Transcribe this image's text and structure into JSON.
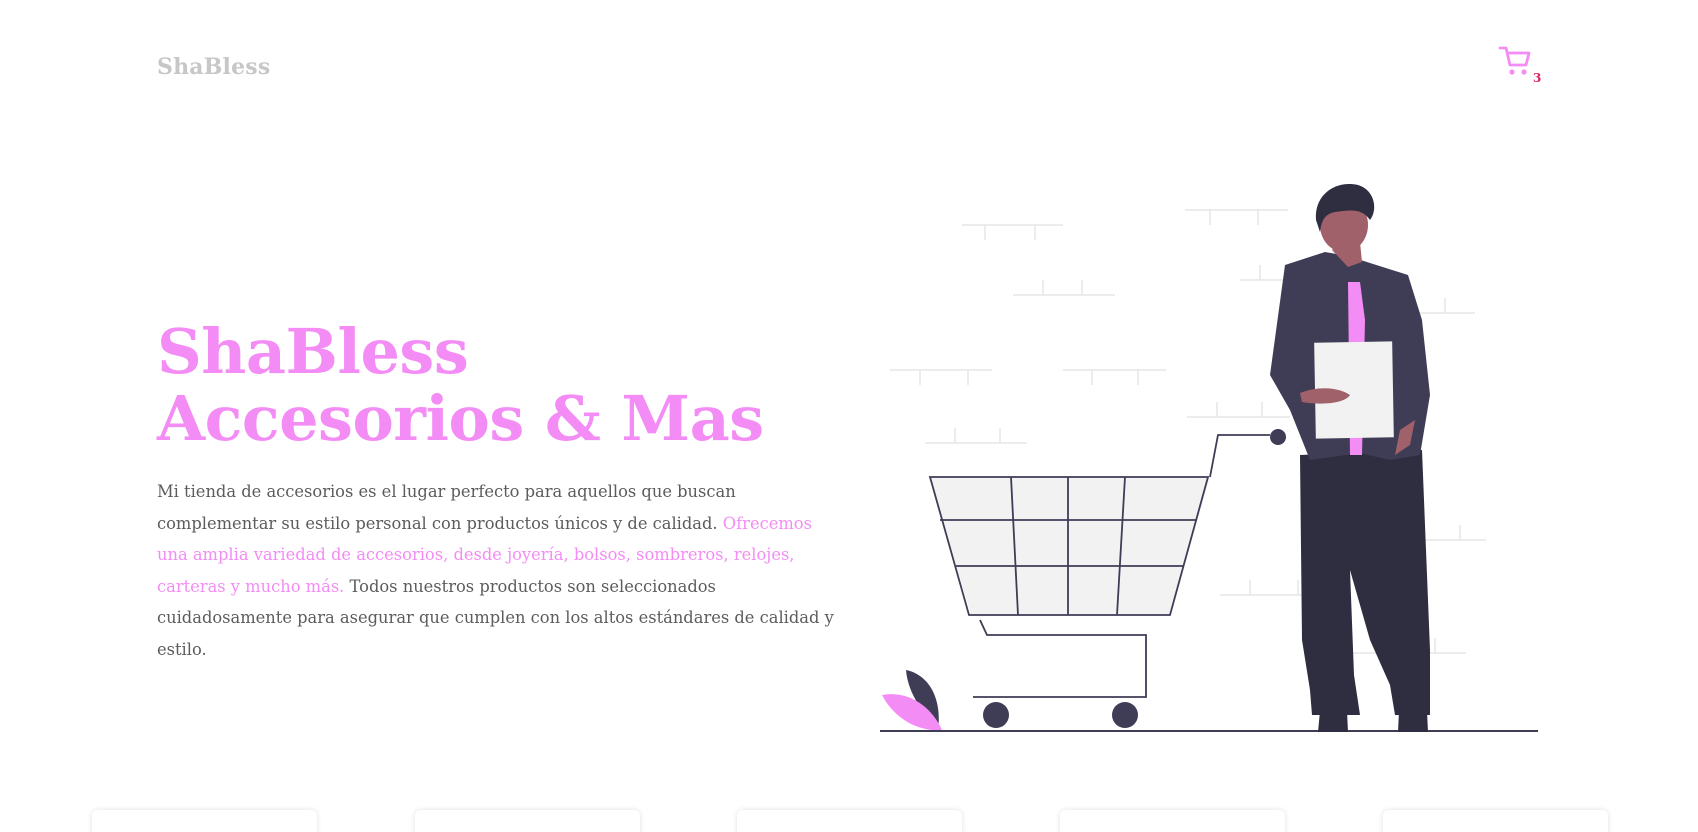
{
  "header": {
    "logo": "ShaBless",
    "cart_count": "3"
  },
  "hero": {
    "title_line1": "ShaBless",
    "title_line2": "Accesorios & Mas",
    "text_part1": "Mi tienda de accesorios es el lugar perfecto para aquellos que buscan complementar su estilo personal con productos únicos y de calidad. ",
    "text_highlight": "Ofrecemos una amplia variedad de accesorios, desde joyería, bolsos, sombreros, relojes, carteras y mucho más.",
    "text_part2": " Todos nuestros productos son seleccionados cuidadosamente para asegurar que cumplen con los altos estándares de calidad y estilo."
  },
  "colors": {
    "accent": "#f48cf6",
    "badge": "#e0245e",
    "dark": "#3f3d56",
    "skin": "#a0616a"
  },
  "icons": {
    "cart": "shopping-cart-icon"
  }
}
